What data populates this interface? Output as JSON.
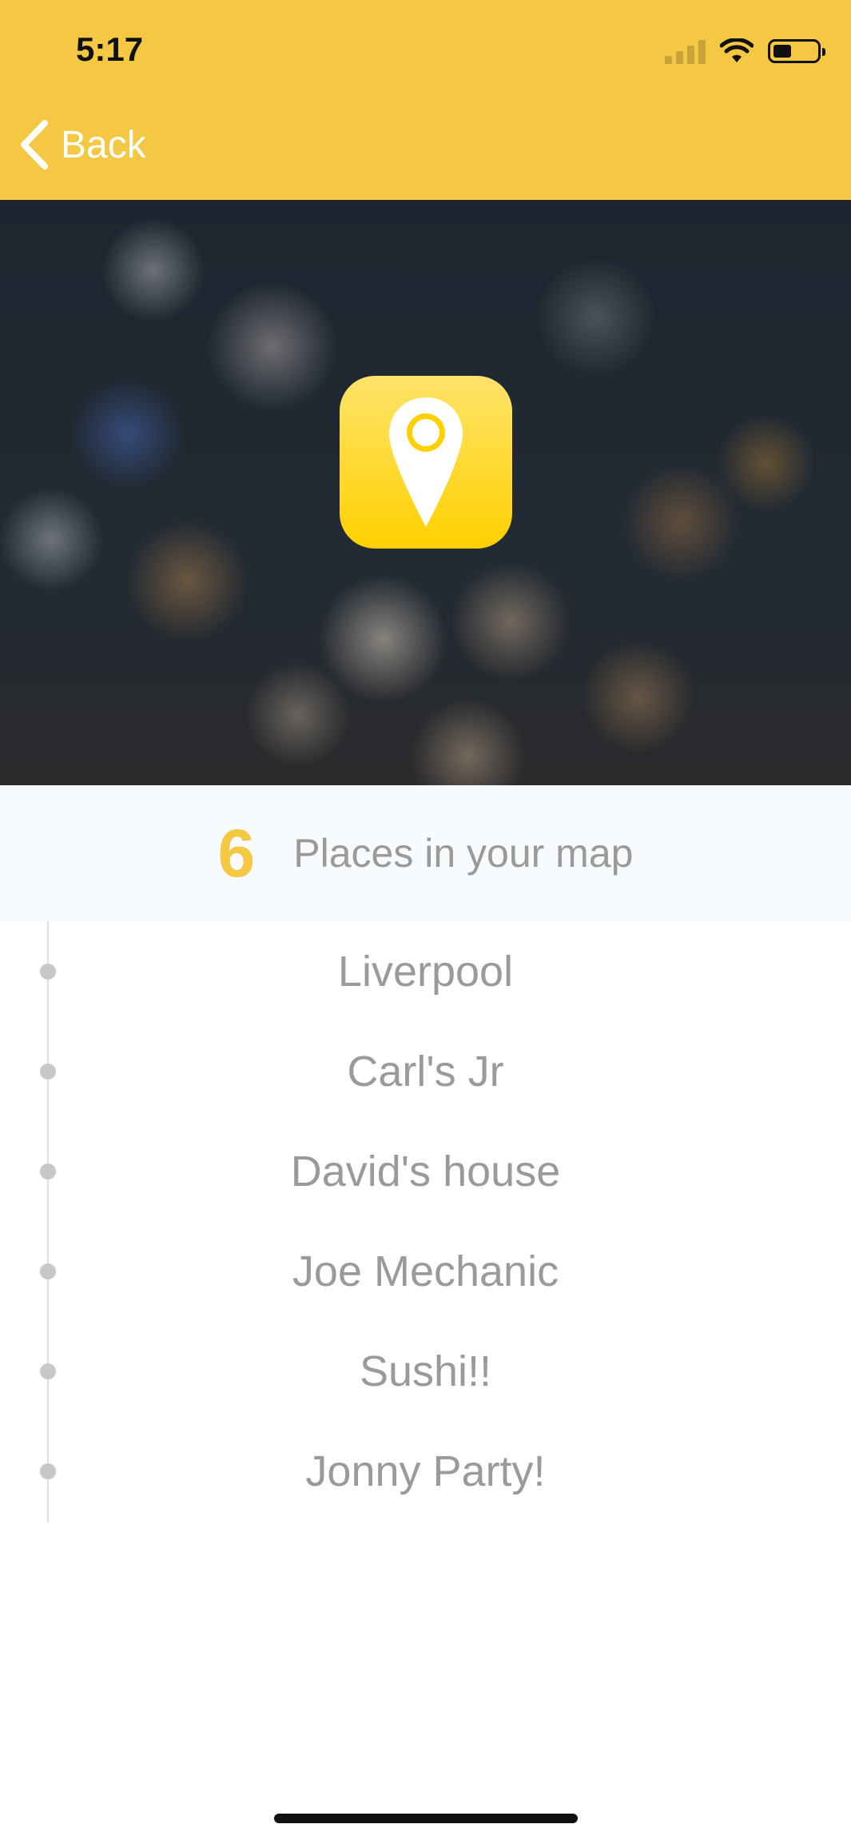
{
  "status_bar": {
    "time": "5:17",
    "icons": [
      "cellular-signal-icon",
      "wifi-icon",
      "battery-icon"
    ]
  },
  "nav": {
    "back_label": "Back",
    "bar_color": "#F5C844"
  },
  "hero": {
    "icon": "map-pin-icon",
    "icon_color": "#FFD000"
  },
  "summary": {
    "count": "6",
    "label": "Places in your map",
    "accent_color": "#F5C844"
  },
  "places": [
    {
      "name": "Liverpool"
    },
    {
      "name": "Carl's Jr"
    },
    {
      "name": "David's house"
    },
    {
      "name": "Joe Mechanic"
    },
    {
      "name": "Sushi!!"
    },
    {
      "name": "Jonny Party!"
    }
  ]
}
